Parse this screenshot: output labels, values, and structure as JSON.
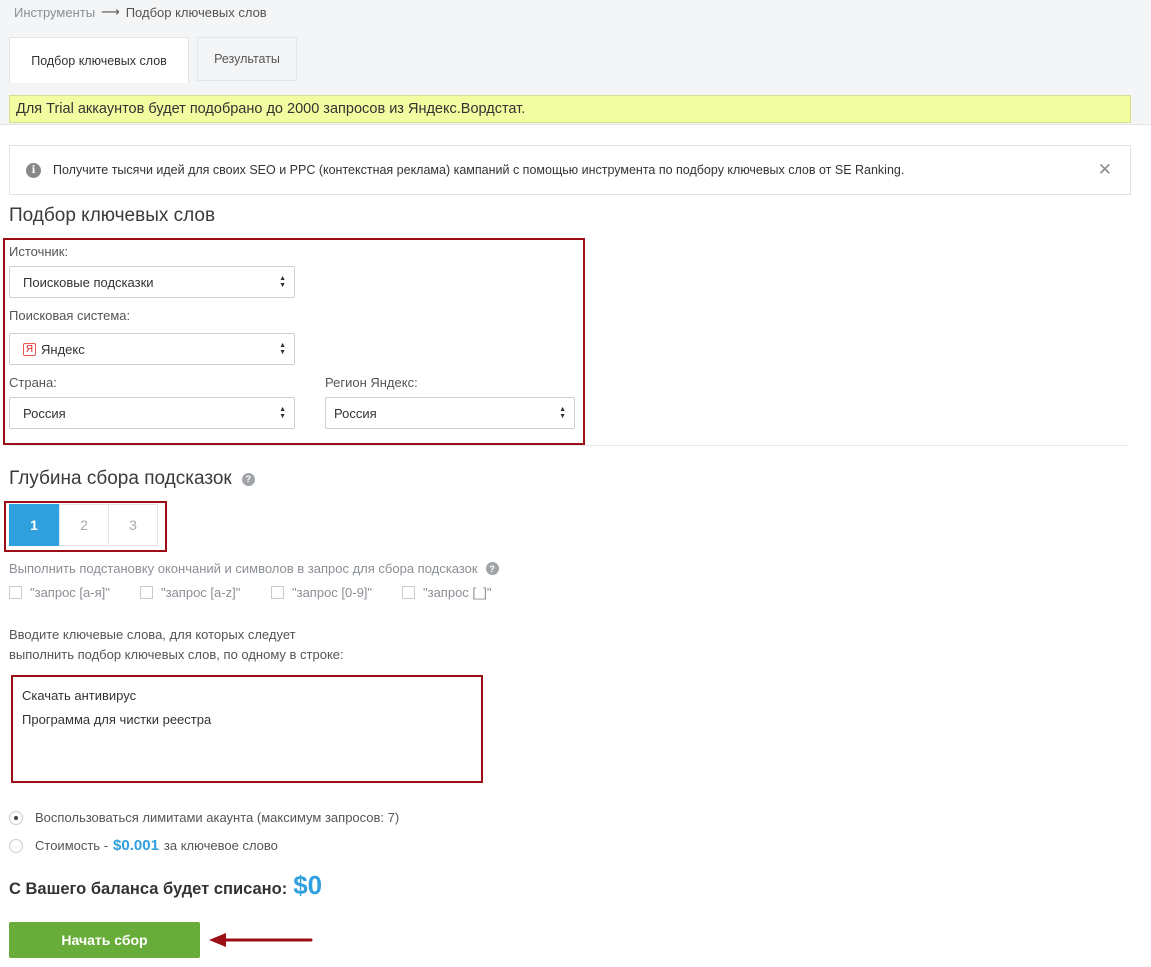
{
  "breadcrumb": {
    "root": "Инструменты",
    "current": "Подбор ключевых слов"
  },
  "tabs": [
    {
      "label": "Подбор ключевых слов",
      "active": true
    },
    {
      "label": "Результаты",
      "active": false
    }
  ],
  "trial_notice": "Для Trial аккаунтов будет подобрано до 2000 запросов из Яндекс.Вордстат.",
  "info_banner": {
    "text": "Получите тысячи идей для своих SEO и PPC (контекстная реклама) кампаний с помощью инструмента по подбору ключевых слов от SE Ranking."
  },
  "section_title": "Подбор ключевых слов",
  "form": {
    "source": {
      "label": "Источник:",
      "value": "Поисковые подсказки"
    },
    "engine": {
      "label": "Поисковая система:",
      "value": "Яндекс",
      "icon_text": "Я"
    },
    "country": {
      "label": "Страна:",
      "value": "Россия"
    },
    "region": {
      "label": "Регион Яндекс:",
      "value": "Россия"
    }
  },
  "depth": {
    "title": "Глубина сбора подсказок",
    "options": [
      "1",
      "2",
      "3"
    ],
    "selected": "1"
  },
  "substitution": {
    "label": "Выполнить подстановку окончаний и символов в запрос для сбора подсказок",
    "options": [
      "\"запрос [а-я]\"",
      "\"запрос [a-z]\"",
      "\"запрос [0-9]\"",
      "\"запрос [_]\""
    ]
  },
  "keywords": {
    "label_line1": "Вводите ключевые слова, для которых следует",
    "label_line2": "выполнить подбор ключевых слов, по одному в строке:",
    "lines": [
      "Скачать антивирус",
      "Программа для чистки реестра"
    ]
  },
  "payment": {
    "option1": "Воспользоваться лимитами акаунта (максимум запросов: 7)",
    "option2_prefix": "Стоимость -",
    "option2_price": "$0.001",
    "option2_suffix": "за ключевое слово",
    "selected": "option1"
  },
  "balance": {
    "label": "С Вашего баланса будет списано:",
    "amount": "$0"
  },
  "start_button": "Начать сбор",
  "colors": {
    "accent": "#2f9fde",
    "button": "#68ad3a",
    "highlight_box": "#9c0f16",
    "trial_bg": "#f2fca0"
  }
}
